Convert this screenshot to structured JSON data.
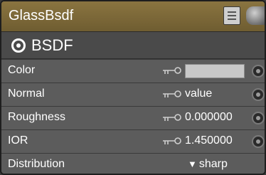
{
  "node": {
    "title": "GlassBsdf",
    "list_icon": "list-icon",
    "preview_icon": "sphere-preview-icon",
    "header_color": "#7d6a39"
  },
  "section": {
    "icon": "output-socket-icon",
    "title": "BSDF"
  },
  "inputs": [
    {
      "label": "Color",
      "type": "color",
      "color_value": "#c8c8c8"
    },
    {
      "label": "Normal",
      "type": "text",
      "value": "value"
    },
    {
      "label": "Roughness",
      "type": "number",
      "value": "0.000000"
    },
    {
      "label": "IOR",
      "type": "number",
      "value": "1.450000"
    },
    {
      "label": "Distribution",
      "type": "dropdown",
      "value": "sharp"
    }
  ]
}
